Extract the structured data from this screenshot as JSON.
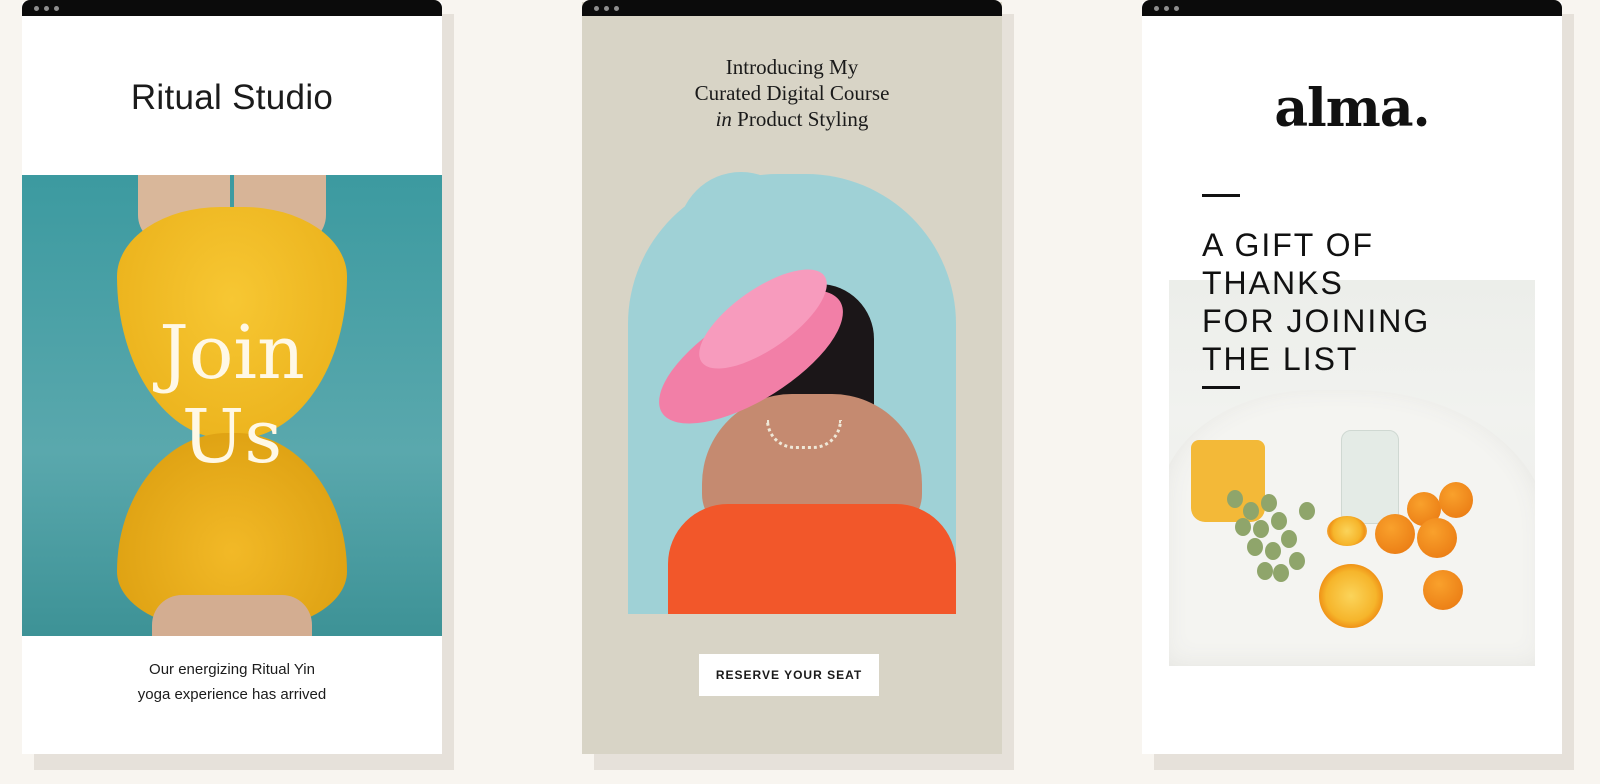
{
  "cards": [
    {
      "brand": "Ritual Studio",
      "hero_text_line1": "Join",
      "hero_text_line2": "Us",
      "subtitle_line1": "Our energizing Ritual Yin",
      "subtitle_line2": "yoga experience has arrived",
      "colors": {
        "photo_bg": "#3c9aa0",
        "accent": "#f2b927"
      },
      "icons": [
        "window-dot-icon",
        "window-dot-icon",
        "window-dot-icon"
      ]
    },
    {
      "headline_line1": "Introducing My",
      "headline_line2": "Curated Digital Course",
      "headline_line3_italic": "in",
      "headline_line3_rest": " Product Styling",
      "button_label": "RESERVE YOUR SEAT",
      "colors": {
        "background": "#d8d4c6",
        "arch": "#9fd1d6",
        "feather": "#f27fa7",
        "dress": "#f2572a"
      }
    },
    {
      "brand": "alma.",
      "headline_lines": [
        "A GIFT OF",
        "THANKS",
        "FOR JOINING",
        "THE LIST"
      ],
      "colors": {
        "text": "#111111",
        "accent": "#f3b324"
      }
    }
  ]
}
